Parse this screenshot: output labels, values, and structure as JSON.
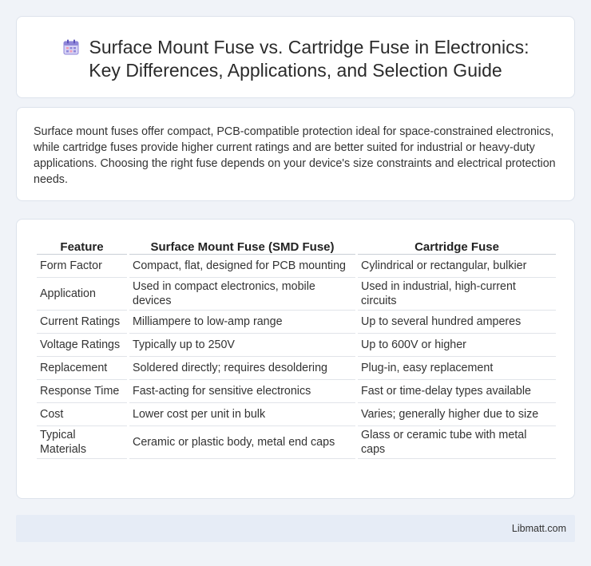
{
  "header": {
    "title_line1": "Surface Mount Fuse vs. Cartridge Fuse in Electronics:",
    "title_line2": "Key Differences, Applications, and Selection Guide",
    "icon": "calendar-icon"
  },
  "summary": {
    "text": "Surface mount fuses offer compact, PCB-compatible protection ideal for space-constrained electronics, while cartridge fuses provide higher current ratings and are better suited for industrial or heavy-duty applications. Choosing the right fuse depends on your device's size constraints and electrical protection needs."
  },
  "table": {
    "headers": [
      "Feature",
      "Surface Mount Fuse (SMD Fuse)",
      "Cartridge Fuse"
    ],
    "rows": [
      [
        "Form Factor",
        "Compact, flat, designed for PCB mounting",
        "Cylindrical or rectangular, bulkier"
      ],
      [
        "Application",
        "Used in compact electronics, mobile devices",
        "Used in industrial, high-current circuits"
      ],
      [
        "Current Ratings",
        "Milliampere to low-amp range",
        "Up to several hundred amperes"
      ],
      [
        "Voltage Ratings",
        "Typically up to 250V",
        "Up to 600V or higher"
      ],
      [
        "Replacement",
        "Soldered directly; requires desoldering",
        "Plug-in, easy replacement"
      ],
      [
        "Response Time",
        "Fast-acting for sensitive electronics",
        "Fast or time-delay types available"
      ],
      [
        "Cost",
        "Lower cost per unit in bulk",
        "Varies; generally higher due to size"
      ],
      [
        "Typical Materials",
        "Ceramic or plastic body, metal end caps",
        "Glass or ceramic tube with metal caps"
      ]
    ]
  },
  "footer": {
    "brand": "Libmatt.com"
  }
}
